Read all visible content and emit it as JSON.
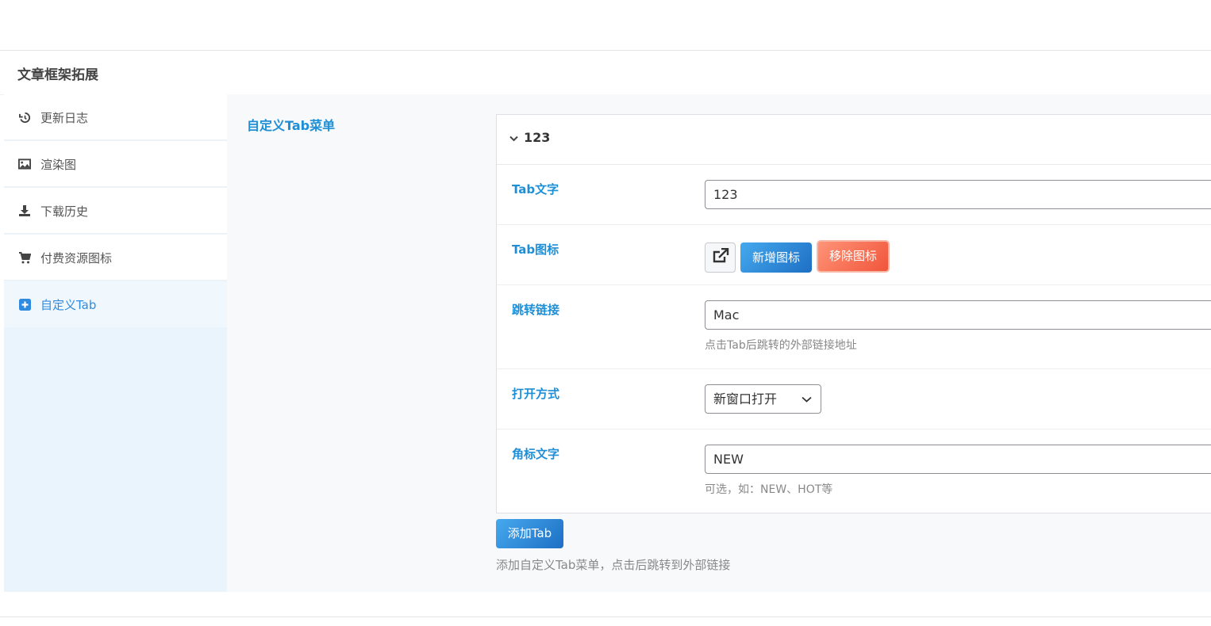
{
  "panel": {
    "title": "文章框架拓展"
  },
  "sidebar": {
    "items": [
      {
        "label": "更新日志",
        "icon": "history-icon"
      },
      {
        "label": "渲染图",
        "icon": "image-icon"
      },
      {
        "label": "下载历史",
        "icon": "download-icon"
      },
      {
        "label": "付费资源图标",
        "icon": "cart-icon"
      },
      {
        "label": "自定义Tab",
        "icon": "plus-square-icon",
        "active": true
      }
    ]
  },
  "main": {
    "field_title": "自定义Tab菜单",
    "group": {
      "title": "123",
      "fields": {
        "tab_text": {
          "label": "Tab文字",
          "value": "123"
        },
        "tab_icon": {
          "label": "Tab图标",
          "add_label": "新增图标",
          "remove_label": "移除图标"
        },
        "link": {
          "label": "跳转链接",
          "value": "Mac",
          "desc": "点击Tab后跳转的外部链接地址"
        },
        "open_mode": {
          "label": "打开方式",
          "selected": "新窗口打开"
        },
        "badge": {
          "label": "角标文字",
          "value": "NEW",
          "desc": "可选，如：NEW、HOT等"
        }
      }
    },
    "add_button": "添加Tab",
    "add_desc": "添加自定义Tab菜单，点击后跳转到外部链接"
  },
  "colors": {
    "accent": "#1e8fd6",
    "active_text": "#2f8be0",
    "danger": "#f0553a"
  }
}
